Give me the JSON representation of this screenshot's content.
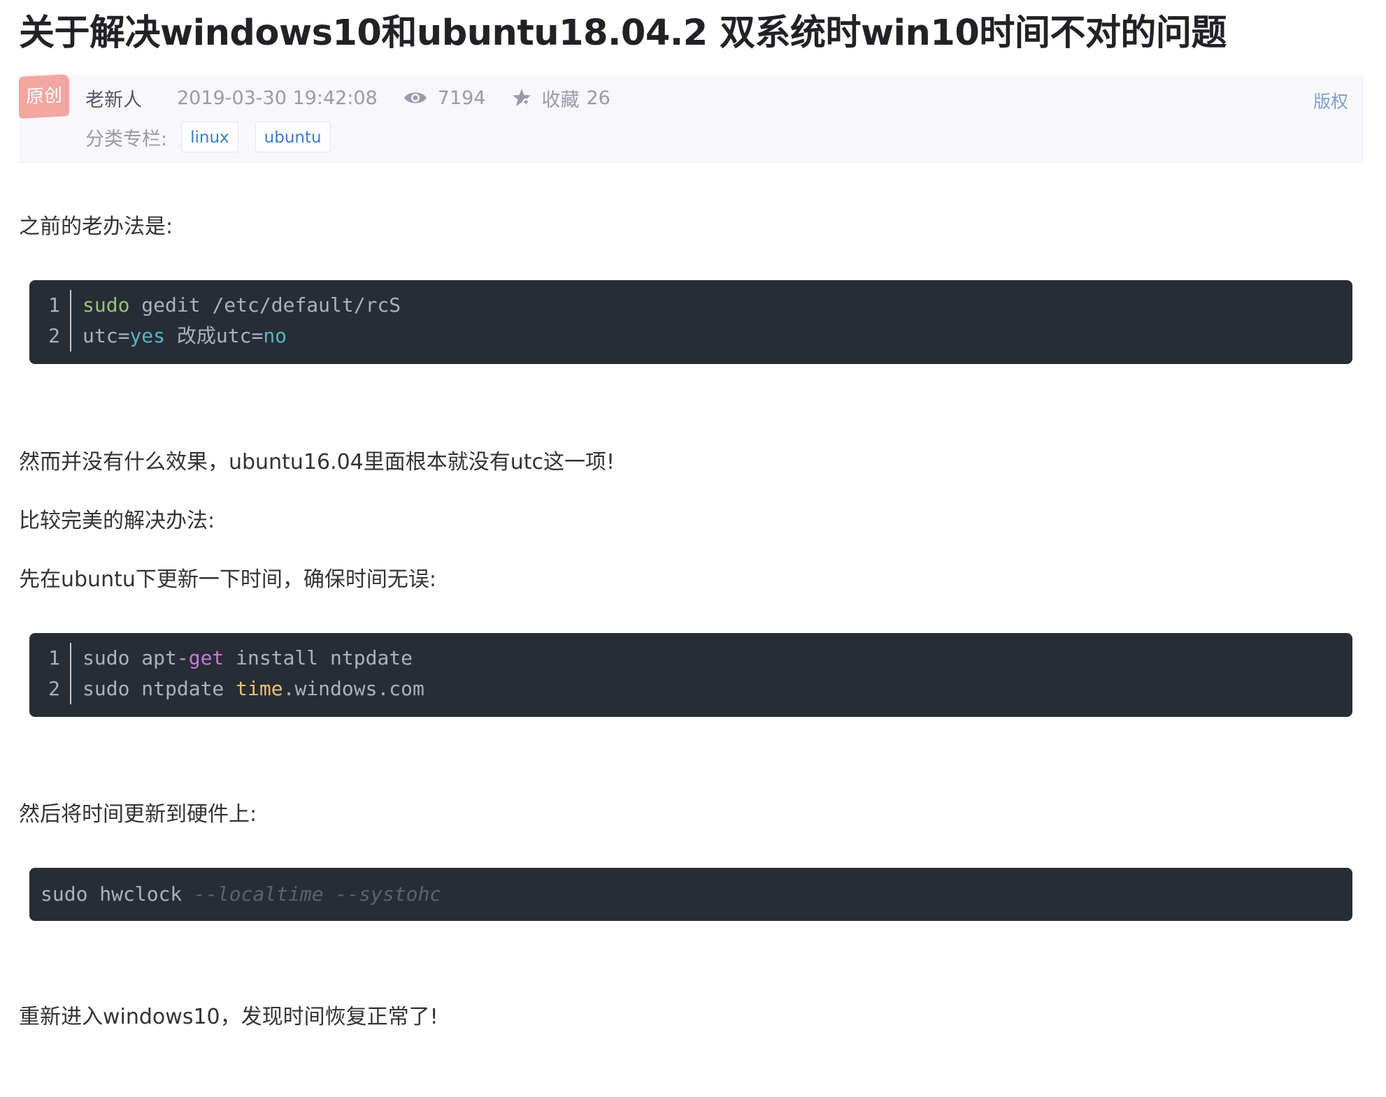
{
  "article": {
    "title": "关于解决windows10和ubuntu18.04.2 双系统时win10时间不对的问题"
  },
  "meta": {
    "badge": "原创",
    "author": "老新人",
    "date": "2019-03-30 19:42:08",
    "views": "7194",
    "favorites_label": "收藏",
    "favorites": "26",
    "rights": "版权",
    "category_label": "分类专栏:",
    "tags": [
      "linux",
      "ubuntu"
    ]
  },
  "content": {
    "p1": "之前的老办法是:",
    "code1": {
      "line1": {
        "num": "1",
        "a": "sudo",
        "b": " gedit /etc/default/rcS"
      },
      "line2": {
        "num": "2",
        "a": "utc=",
        "b": "yes",
        "c": " 改成utc=",
        "d": "no"
      }
    },
    "p2": "然而并没有什么效果，ubuntu16.04里面根本就没有utc这一项!",
    "p3": "比较完美的解决办法:",
    "p4": "先在ubuntu下更新一下时间，确保时间无误:",
    "code2": {
      "line1": {
        "num": "1",
        "a": "sudo apt-",
        "b": "get",
        "c": " install ntpdate"
      },
      "line2": {
        "num": "2",
        "a": "sudo ntpdate ",
        "b": "time",
        "c": ".windows.com"
      }
    },
    "p5": "然后将时间更新到硬件上:",
    "code3": {
      "a": "sudo hwclock ",
      "b": "--localtime --systohc"
    },
    "p6": "重新进入windows10，发现时间恢复正常了!"
  },
  "colors": {
    "code_bg": "#282c34",
    "link": "#3a7bd5",
    "badge": "#f4a6a0"
  },
  "icons": [
    "eye-icon",
    "star-icon"
  ]
}
